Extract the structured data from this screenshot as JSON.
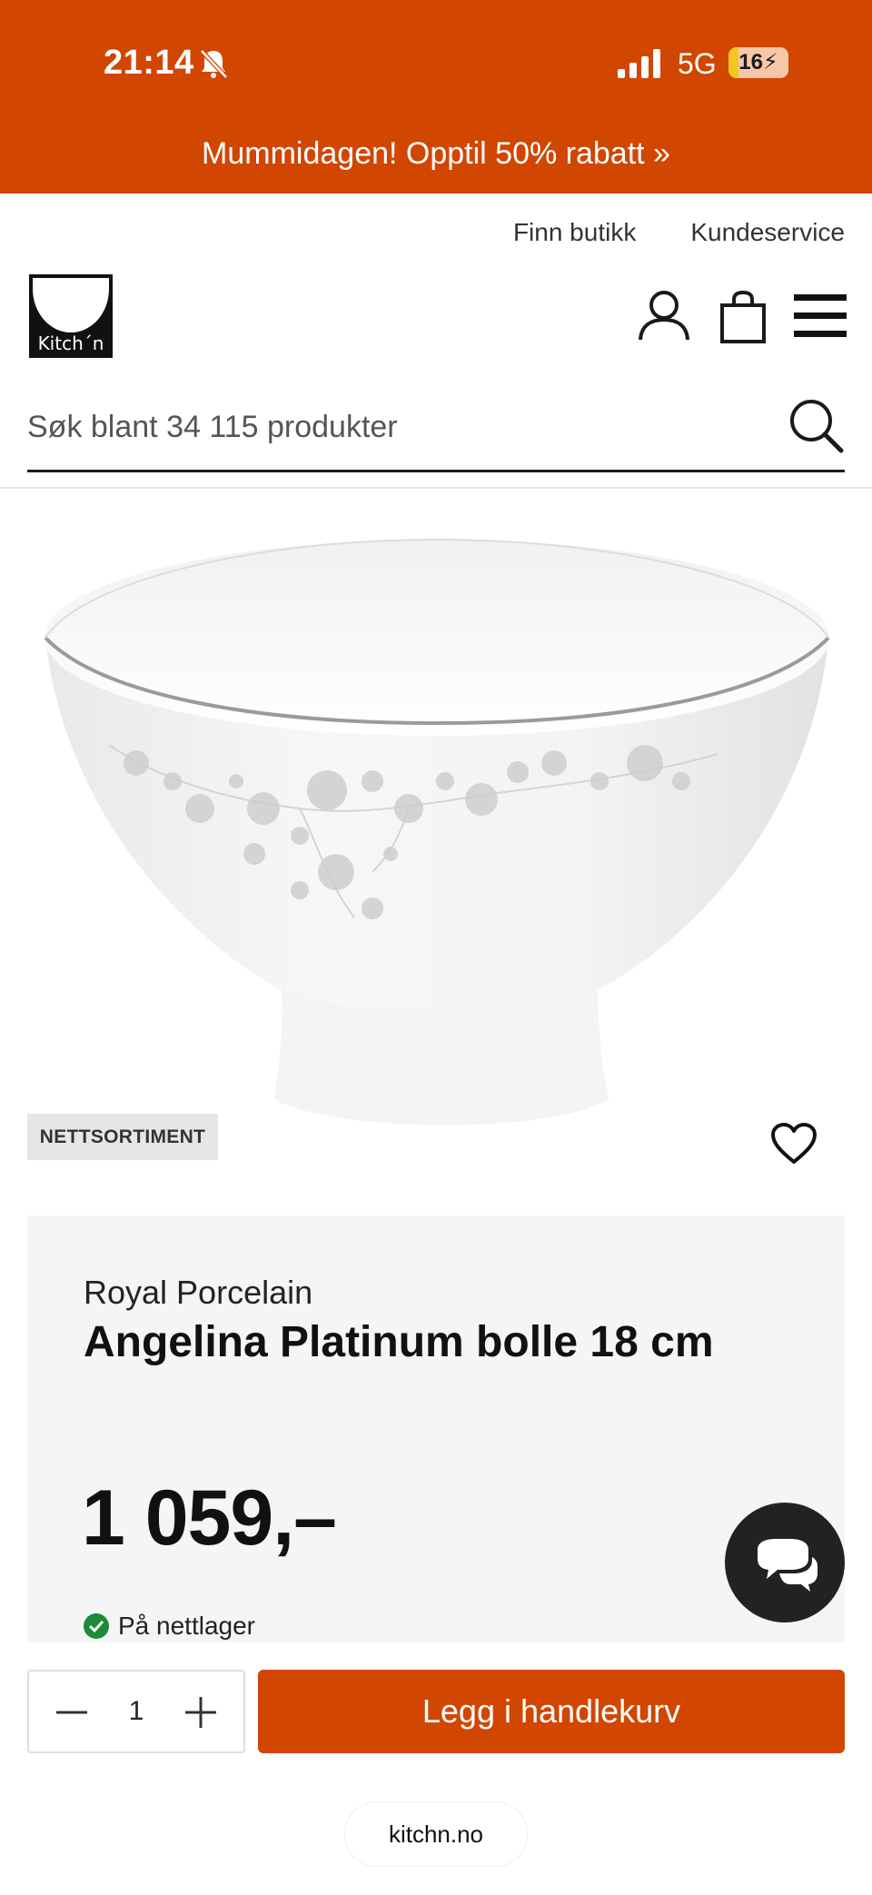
{
  "status_bar": {
    "time": "21:14",
    "network": "5G",
    "battery_level": "16",
    "battery_fraction": 0.16,
    "icons": [
      "bell-slash-icon",
      "signal-icon",
      "battery-charging-icon"
    ]
  },
  "promo_banner": {
    "text": "Mummidagen! Opptil 50% rabatt »",
    "color": "#d14600"
  },
  "header": {
    "links": [
      "Finn butikk",
      "Kundeservice"
    ],
    "logo_text": "Kitch´n",
    "icons": [
      "user-icon",
      "shopping-bag-icon",
      "menu-icon"
    ]
  },
  "search": {
    "placeholder": "Søk blant 34 115 produkter",
    "icon": "search-icon"
  },
  "product": {
    "badge": "NETTSORTIMENT",
    "brand": "Royal Porcelain",
    "name": "Angelina Platinum bolle 18 cm",
    "price": "1 059,–",
    "stock": "På nettlager",
    "image": "white porcelain bowl with platinum rim and grey floral pattern"
  },
  "cart": {
    "quantity": "1",
    "add_label": "Legg i handlekurv",
    "accent": "#d14600"
  },
  "browser": {
    "url": "kitchn.no"
  }
}
